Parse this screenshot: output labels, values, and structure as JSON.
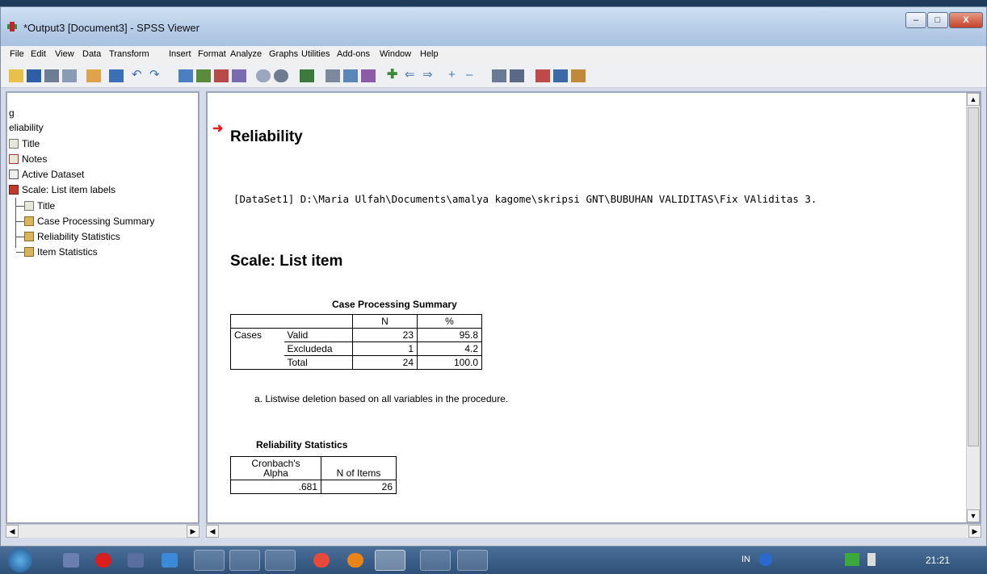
{
  "window": {
    "title": "*Output3 [Document3] - SPSS Viewer"
  },
  "menu": [
    "File",
    "Edit",
    "View",
    "Data",
    "Transform",
    "Insert",
    "Format",
    "Analyze",
    "Graphs",
    "Utilities",
    "Add-ons",
    "Window",
    "Help"
  ],
  "outline": {
    "items": [
      "g",
      "eliability",
      "Title",
      "Notes",
      "Active Dataset",
      "Scale: List item labels",
      "Title",
      "Case Processing Summary",
      "Reliability Statistics",
      "Item Statistics"
    ]
  },
  "output": {
    "heading": "Reliability",
    "dataset_line": "[DataSet1] D:\\Maria Ulfah\\Documents\\amalya kagome\\skripsi GNT\\BUBUHAN VALIDITAS\\Fix VAliditas 3.",
    "scale_heading": "Scale: List item",
    "cps": {
      "title": "Case Processing Summary",
      "col_n": "N",
      "col_pct": "%",
      "cases": "Cases",
      "rows": [
        {
          "label": "Valid",
          "n": "23",
          "pct": "95.8"
        },
        {
          "label": "Excludeda",
          "n": "1",
          "pct": "4.2"
        },
        {
          "label": "Total",
          "n": "24",
          "pct": "100.0"
        }
      ],
      "footnote": "a. Listwise deletion based on all variables in the procedure."
    },
    "rel": {
      "title": "Reliability Statistics",
      "col1a": "Cronbach's",
      "col1b": "Alpha",
      "col2": "N of Items",
      "alpha": ".681",
      "items": "26"
    }
  },
  "taskbar": {
    "lang": "IN",
    "clock": "21:21"
  }
}
